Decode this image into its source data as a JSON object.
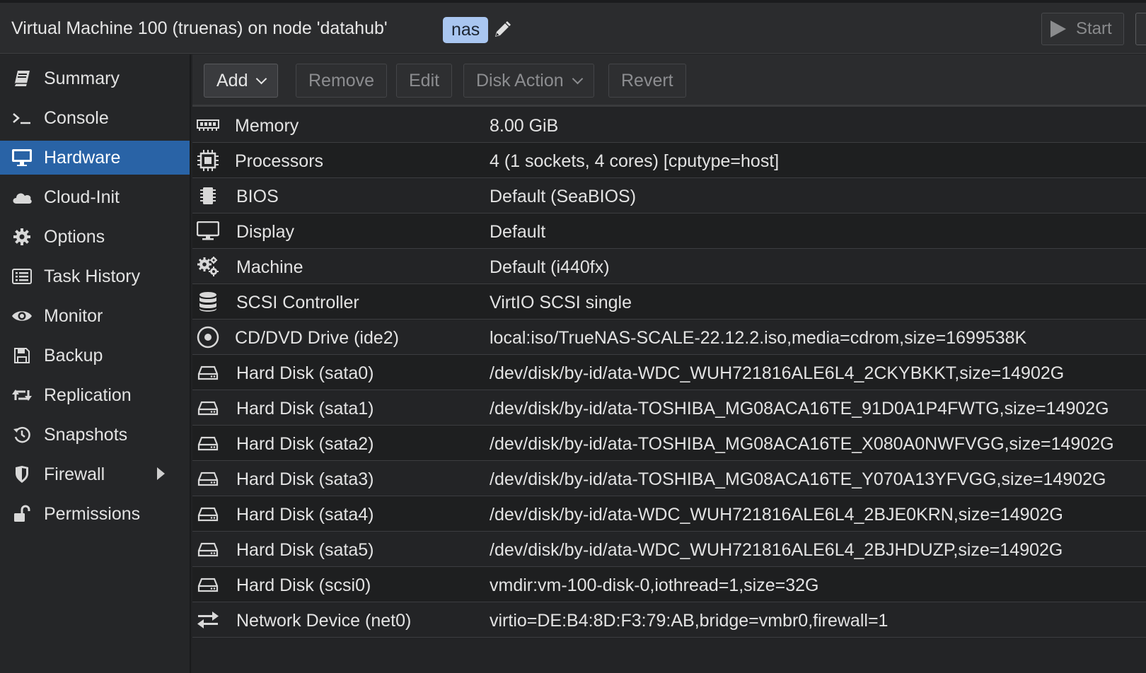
{
  "header": {
    "title": "Virtual Machine 100 (truenas) on node 'datahub'",
    "tag": "nas",
    "start_label": "Start"
  },
  "sidebar": {
    "items": [
      {
        "label": "Summary",
        "icon": "book-icon"
      },
      {
        "label": "Console",
        "icon": "terminal-icon"
      },
      {
        "label": "Hardware",
        "icon": "desktop-icon",
        "active": true
      },
      {
        "label": "Cloud-Init",
        "icon": "cloud-icon"
      },
      {
        "label": "Options",
        "icon": "gear-icon"
      },
      {
        "label": "Task History",
        "icon": "list-icon"
      },
      {
        "label": "Monitor",
        "icon": "eye-icon"
      },
      {
        "label": "Backup",
        "icon": "floppy-icon"
      },
      {
        "label": "Replication",
        "icon": "retweet-icon"
      },
      {
        "label": "Snapshots",
        "icon": "history-icon"
      },
      {
        "label": "Firewall",
        "icon": "shield-icon"
      },
      {
        "label": "Permissions",
        "icon": "unlock-icon"
      }
    ]
  },
  "toolbar": {
    "add": "Add",
    "remove": "Remove",
    "edit": "Edit",
    "disk_action": "Disk Action",
    "revert": "Revert"
  },
  "hardware": [
    {
      "name": "Memory",
      "value": "8.00 GiB",
      "icon": "memory-icon"
    },
    {
      "name": "Processors",
      "value": "4 (1 sockets, 4 cores) [cputype=host]",
      "icon": "cpu-icon"
    },
    {
      "name": "BIOS",
      "value": "Default (SeaBIOS)",
      "icon": "chip-icon"
    },
    {
      "name": "Display",
      "value": "Default",
      "icon": "desktop-icon"
    },
    {
      "name": "Machine",
      "value": "Default (i440fx)",
      "icon": "gears-icon"
    },
    {
      "name": "SCSI Controller",
      "value": "VirtIO SCSI single",
      "icon": "database-icon"
    },
    {
      "name": "CD/DVD Drive (ide2)",
      "value": "local:iso/TrueNAS-SCALE-22.12.2.iso,media=cdrom,size=1699538K",
      "icon": "cdrom-icon"
    },
    {
      "name": "Hard Disk (sata0)",
      "value": "/dev/disk/by-id/ata-WDC_WUH721816ALE6L4_2CKYBKKT,size=14902G",
      "icon": "hdd-icon"
    },
    {
      "name": "Hard Disk (sata1)",
      "value": "/dev/disk/by-id/ata-TOSHIBA_MG08ACA16TE_91D0A1P4FWTG,size=14902G",
      "icon": "hdd-icon"
    },
    {
      "name": "Hard Disk (sata2)",
      "value": "/dev/disk/by-id/ata-TOSHIBA_MG08ACA16TE_X080A0NWFVGG,size=14902G",
      "icon": "hdd-icon"
    },
    {
      "name": "Hard Disk (sata3)",
      "value": "/dev/disk/by-id/ata-TOSHIBA_MG08ACA16TE_Y070A13YFVGG,size=14902G",
      "icon": "hdd-icon"
    },
    {
      "name": "Hard Disk (sata4)",
      "value": "/dev/disk/by-id/ata-WDC_WUH721816ALE6L4_2BJE0KRN,size=14902G",
      "icon": "hdd-icon"
    },
    {
      "name": "Hard Disk (sata5)",
      "value": "/dev/disk/by-id/ata-WDC_WUH721816ALE6L4_2BJHDUZP,size=14902G",
      "icon": "hdd-icon"
    },
    {
      "name": "Hard Disk (scsi0)",
      "value": "vmdir:vm-100-disk-0,iothread=1,size=32G",
      "icon": "hdd-icon"
    },
    {
      "name": "Network Device (net0)",
      "value": "virtio=DE:B4:8D:F3:79:AB,bridge=vmbr0,firewall=1",
      "icon": "exchange-icon"
    }
  ]
}
